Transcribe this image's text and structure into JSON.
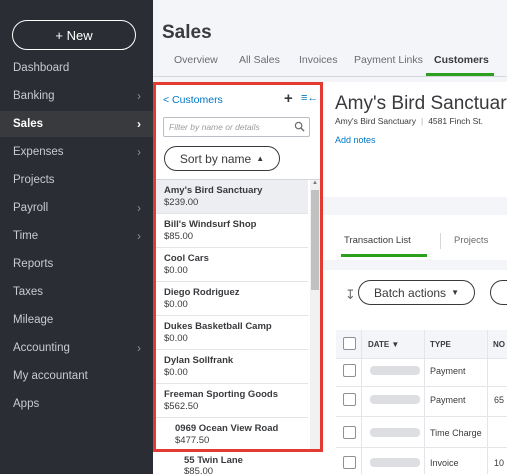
{
  "nav": {
    "new_label": "+ New",
    "items": [
      {
        "label": "Dashboard",
        "chevron": false
      },
      {
        "label": "Banking",
        "chevron": true
      },
      {
        "label": "Sales",
        "chevron": true,
        "active": true
      },
      {
        "label": "Expenses",
        "chevron": true
      },
      {
        "label": "Projects",
        "chevron": false
      },
      {
        "label": "Payroll",
        "chevron": true
      },
      {
        "label": "Time",
        "chevron": true
      },
      {
        "label": "Reports",
        "chevron": false
      },
      {
        "label": "Taxes",
        "chevron": false
      },
      {
        "label": "Mileage",
        "chevron": false
      },
      {
        "label": "Accounting",
        "chevron": true
      },
      {
        "label": "My accountant",
        "chevron": false
      },
      {
        "label": "Apps",
        "chevron": false
      }
    ]
  },
  "header": {
    "title": "Sales",
    "tabs": [
      "Overview",
      "All Sales",
      "Invoices",
      "Payment Links",
      "Customers"
    ],
    "active_tab": "Customers"
  },
  "panel": {
    "back_label": "< Customers",
    "add_icon": "+",
    "collapse_icon": "≡←",
    "filter_placeholder": "Filter by name or details",
    "sort_label": "Sort by name",
    "customers": [
      {
        "name": "Amy's Bird Sanctuary",
        "balance": "$239.00",
        "selected": true
      },
      {
        "name": "Bill's Windsurf Shop",
        "balance": "$85.00"
      },
      {
        "name": "Cool Cars",
        "balance": "$0.00"
      },
      {
        "name": "Diego Rodriguez",
        "balance": "$0.00"
      },
      {
        "name": "Dukes Basketball Camp",
        "balance": "$0.00"
      },
      {
        "name": "Dylan Sollfrank",
        "balance": "$0.00"
      },
      {
        "name": "Freeman Sporting Goods",
        "balance": "$562.50"
      },
      {
        "name": "0969 Ocean View Road",
        "balance": "$477.50",
        "sub": true
      }
    ],
    "outside_row": {
      "name": "55 Twin Lane",
      "balance": "$85.00"
    }
  },
  "detail": {
    "name": "Amy's Bird Sanctuary",
    "company": "Amy's Bird Sanctuary",
    "address": "4581 Finch St.",
    "add_notes": "Add notes",
    "sub_tabs": [
      "Transaction List",
      "Projects"
    ],
    "batch_label": "Batch actions",
    "columns": [
      "DATE ▼",
      "TYPE",
      "NO"
    ],
    "rows": [
      {
        "type": "Payment",
        "no": ""
      },
      {
        "type": "Payment",
        "no": "65"
      },
      {
        "type": "Time Charge",
        "no": ""
      },
      {
        "type": "Invoice",
        "no": "10"
      }
    ]
  },
  "colors": {
    "accent": "#2ca01c",
    "link": "#0077c5",
    "highlight": "#e23b32",
    "nav_bg": "#2a2d33"
  }
}
